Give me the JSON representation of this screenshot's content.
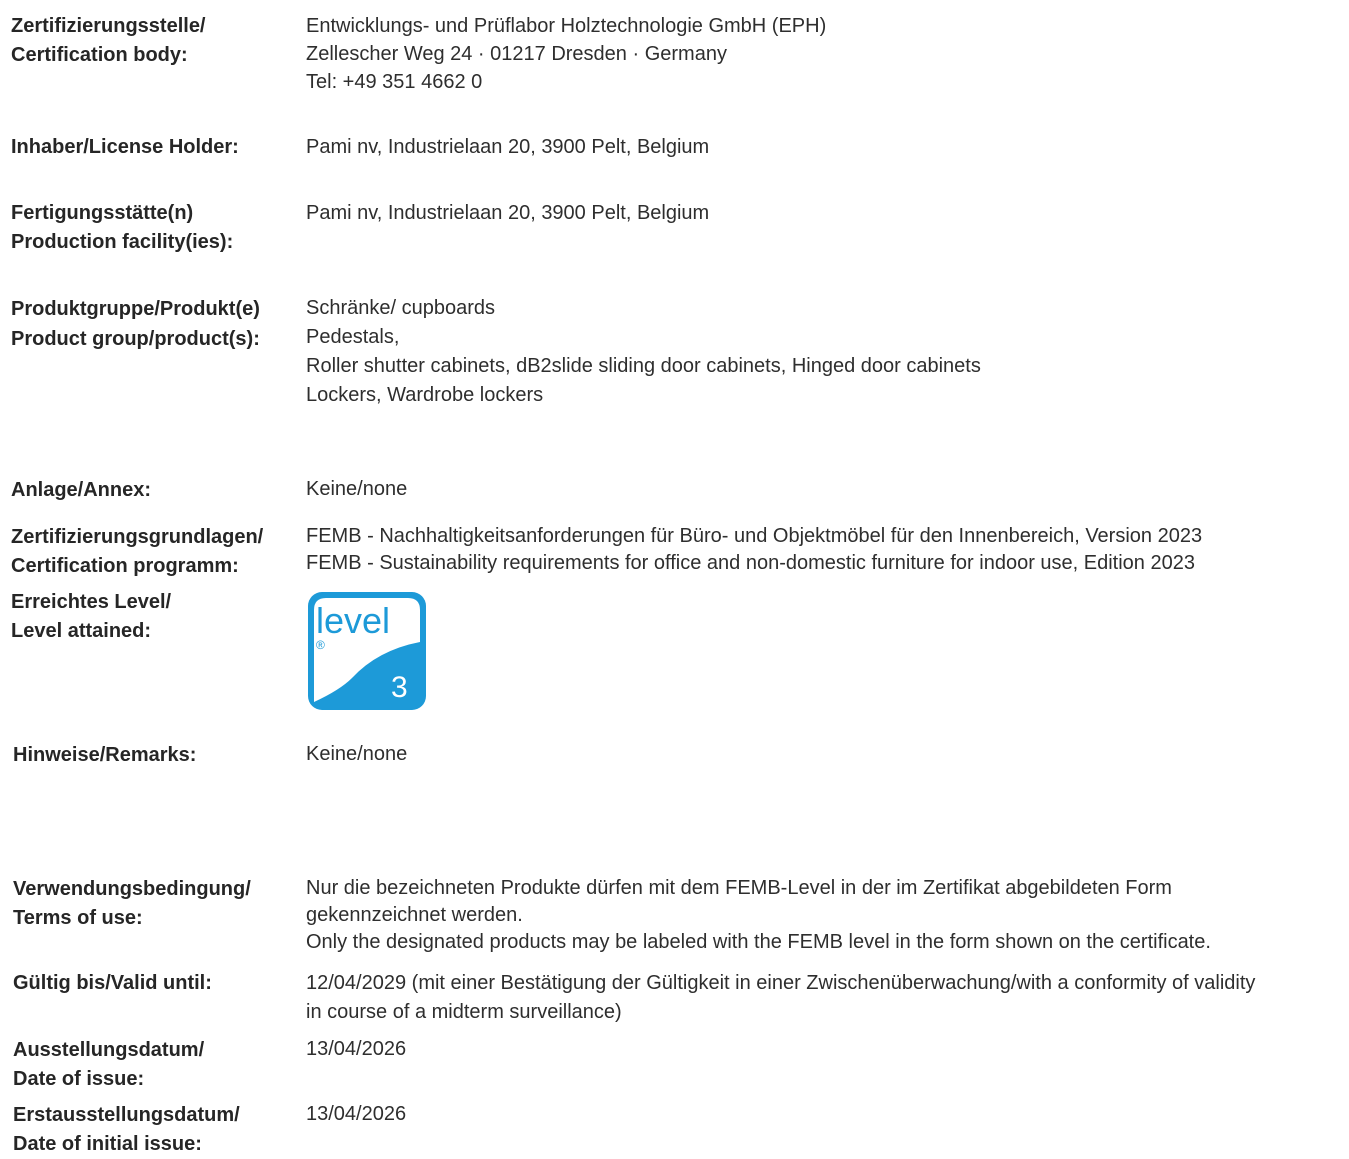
{
  "cert_body": {
    "label": [
      "Zertifizierungsstelle/",
      "Certification body:"
    ],
    "value": [
      "Entwicklungs- und Prüflabor Holztechnologie GmbH (EPH)",
      "Zellescher Weg 24 · 01217 Dresden · Germany",
      "Tel: +49 351 4662 0"
    ]
  },
  "license_holder": {
    "label": [
      "Inhaber/License Holder:"
    ],
    "value": [
      "Pami nv, Industrielaan 20, 3900 Pelt, Belgium"
    ]
  },
  "production": {
    "label": [
      "Fertigungsstätte(n)",
      "Production facility(ies):"
    ],
    "value": [
      "Pami nv, Industrielaan 20, 3900 Pelt, Belgium"
    ]
  },
  "products": {
    "label": [
      "Produktgruppe/Produkt(e)",
      "Product group/product(s):"
    ],
    "value": [
      "Schränke/ cupboards",
      "Pedestals,",
      "Roller shutter cabinets, dB2slide sliding door cabinets, Hinged door cabinets",
      "Lockers, Wardrobe lockers"
    ]
  },
  "annex": {
    "label": [
      "Anlage/Annex:"
    ],
    "value": [
      "Keine/none"
    ]
  },
  "programme": {
    "label": [
      "Zertifizierungsgrundlagen/",
      "Certification programm:"
    ],
    "value": [
      "FEMB - Nachhaltigkeitsanforderungen für Büro- und Objektmöbel für den Innenbereich, Version 2023",
      "FEMB - Sustainability requirements for office and non-domestic furniture for indoor use, Edition 2023"
    ]
  },
  "level": {
    "label": [
      "Erreichtes Level/",
      "Level attained:"
    ],
    "logo_word": "level",
    "logo_mark": "®",
    "logo_number": "3",
    "colors": {
      "blue": "#1d9ad8",
      "white": "#ffffff"
    }
  },
  "remarks": {
    "label": [
      "Hinweise/Remarks:"
    ],
    "value": [
      "Keine/none"
    ]
  },
  "terms": {
    "label": [
      "Verwendungsbedingung/",
      "Terms of use:"
    ],
    "value": [
      "Nur die bezeichneten Produkte dürfen mit dem FEMB-Level in der im Zertifikat abgebildeten Form",
      "gekennzeichnet werden.",
      "Only the designated products may be labeled with the FEMB level in the form shown on the certificate."
    ]
  },
  "valid_until": {
    "label": [
      "Gültig bis/Valid until:"
    ],
    "value": [
      "12/04/2029 (mit einer Bestätigung der Gültigkeit in einer Zwischenüberwachung/with a conformity of validity",
      "in course of a midterm surveillance)"
    ]
  },
  "date_issue": {
    "label": [
      "Ausstellungsdatum/",
      "Date of issue:"
    ],
    "value": [
      "13/04/2026"
    ]
  },
  "initial_issue": {
    "label": [
      "Erstausstellungsdatum/",
      "Date of initial issue:"
    ],
    "value": [
      "13/04/2026"
    ]
  }
}
